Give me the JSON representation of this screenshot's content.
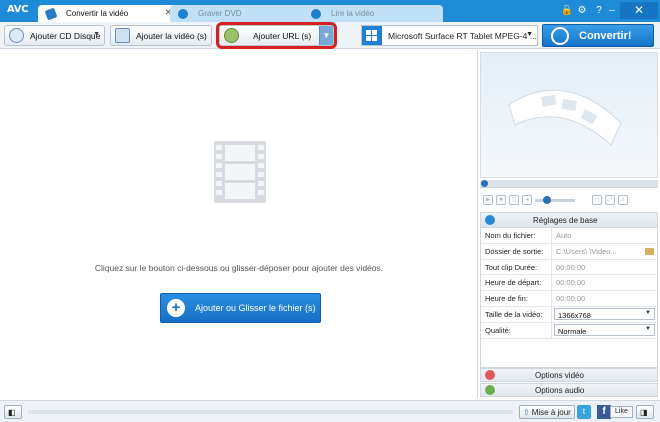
{
  "app": {
    "logo": "AVC"
  },
  "tabs": [
    {
      "label": "Convertir la vidéo",
      "active": true
    },
    {
      "label": "Graver DVD",
      "active": false
    },
    {
      "label": "Lire la vidéo",
      "active": false
    }
  ],
  "window_controls": {
    "lock": "🔒",
    "settings": "⚙",
    "help": "?",
    "minimize": "–",
    "close": "✕"
  },
  "toolbar": {
    "add_cd_label": "Ajouter CD Disque",
    "add_video_label": "Ajouter la vidéo (s)",
    "add_url_label": "Ajouter URL (s)",
    "profile_label": "Microsoft Surface RT Tablet MPEG-4 ...",
    "convert_label": "Convertir!"
  },
  "main": {
    "hint": "Cliquez sur le bouton ci-dessous ou glisser-déposer pour ajouter des vidéos.",
    "add_button_label": "Ajouter ou Glisser le fichier (s)"
  },
  "settings": {
    "title": "Réglages de base",
    "rows": [
      {
        "key": "Nom du fichier:",
        "value": "Auto"
      },
      {
        "key": "Dossier de sortie:",
        "value": "C:\\Users\\          \\Video..."
      },
      {
        "key": "Tout clip Durée:",
        "value": "00:00:00"
      },
      {
        "key": "Heure de départ:",
        "value": "00:00:00"
      },
      {
        "key": "Heure de fin:",
        "value": "00:00:00"
      },
      {
        "key": "Taille de la vidéo:",
        "value": "1366x768"
      },
      {
        "key": "Qualité:",
        "value": "Normale"
      }
    ]
  },
  "options": {
    "video": "Options vidéo",
    "audio": "Options audio"
  },
  "statusbar": {
    "update_label": "Mise à jour",
    "like_label": "Like",
    "fb": "f"
  },
  "colors": {
    "accent": "#1e8bd8",
    "highlight": "#d42020"
  }
}
